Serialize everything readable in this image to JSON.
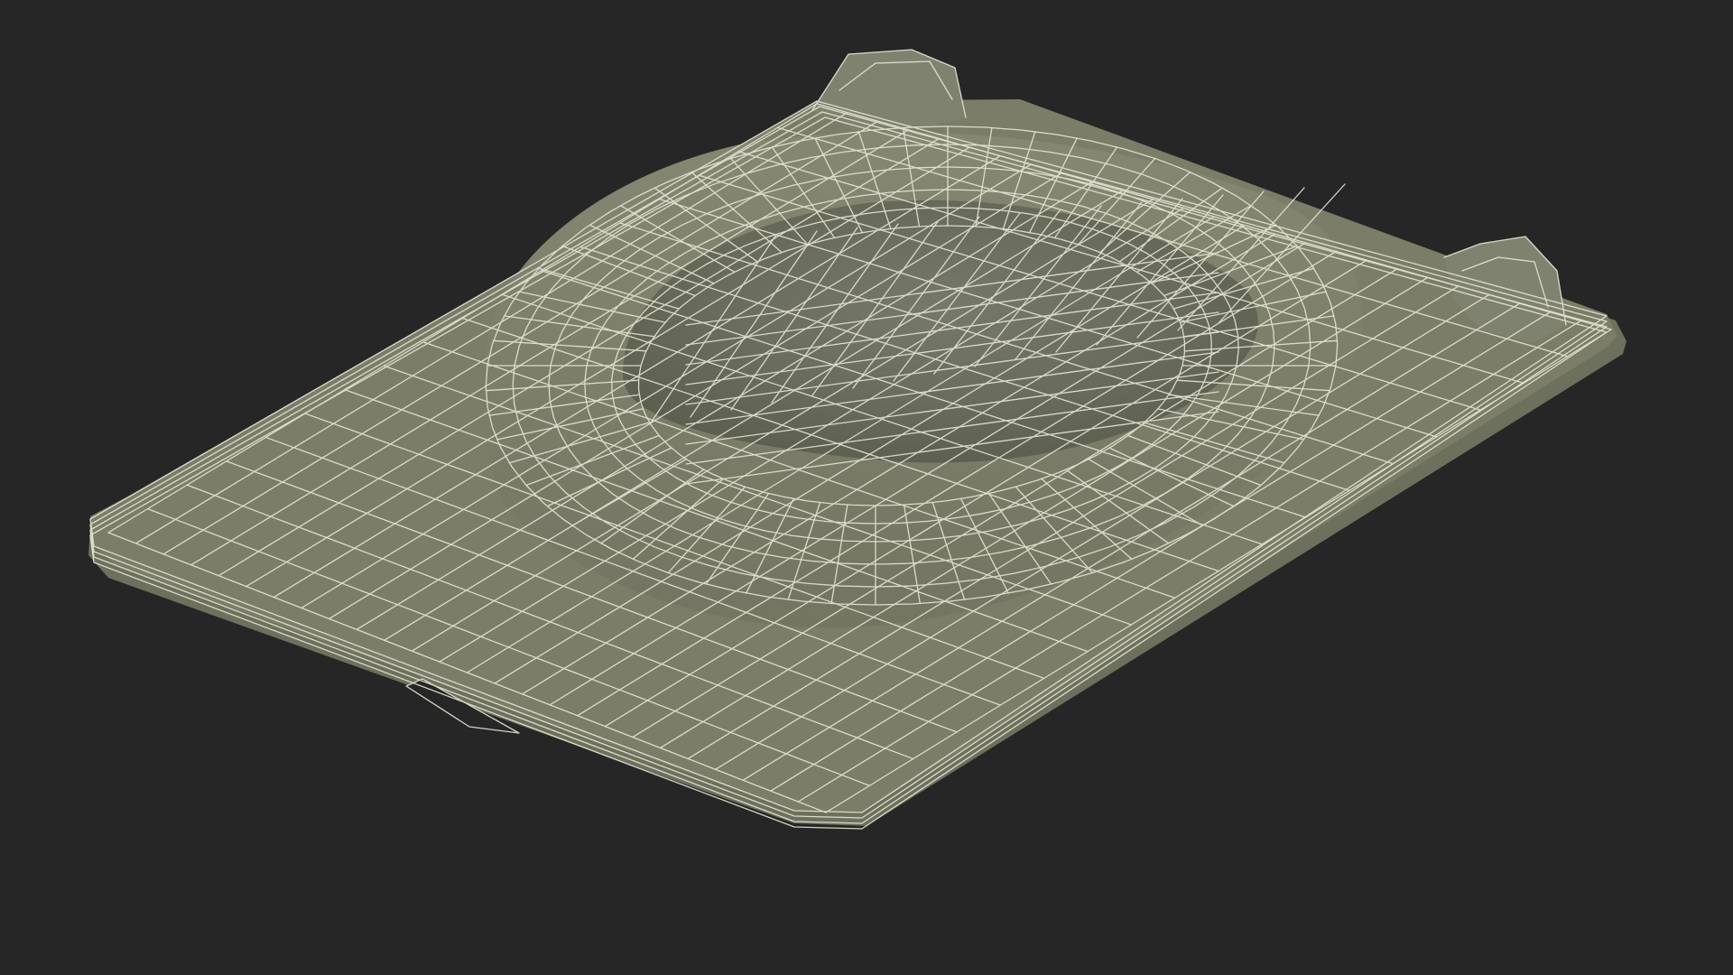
{
  "scene": {
    "subject": "tray-wireframe",
    "colors": {
      "background": "#262626",
      "surface": "#7b7d68",
      "surface_dark": "#6c6e5b",
      "surface_shadow": "#5d5f4f",
      "surface_light": "#868873",
      "wire": "#e8e6d6",
      "hole": "#262626"
    }
  }
}
